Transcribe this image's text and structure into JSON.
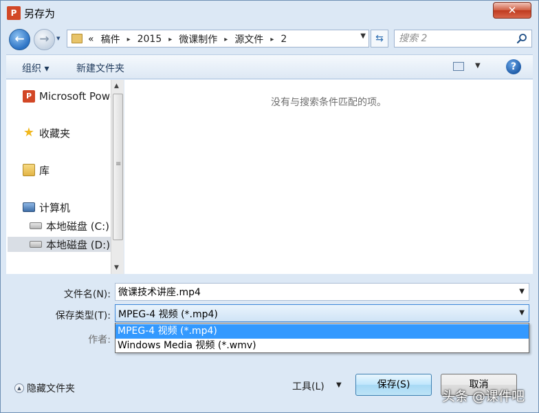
{
  "window": {
    "title": "另存为",
    "close_glyph": "✕"
  },
  "address": {
    "back_glyph": "←",
    "forward_glyph": "→",
    "history_glyph": "▾",
    "overflow": "«",
    "crumbs": [
      "稿件",
      "2015",
      "微课制作",
      "源文件",
      "2"
    ],
    "crumb_separator": "▸",
    "dropdown_glyph": "▼",
    "refresh_glyph": "⇆",
    "search_placeholder": "搜索 2"
  },
  "toolbar": {
    "organize_label": "组织 ▾",
    "new_folder_label": "新建文件夹",
    "view_drop_glyph": "▼",
    "help_glyph": "?"
  },
  "nav": {
    "items": [
      {
        "label": "Microsoft PowerPoint",
        "icon": "powerpoint-icon"
      },
      {
        "label": "收藏夹",
        "icon": "star-icon"
      },
      {
        "label": "库",
        "icon": "library-icon"
      },
      {
        "label": "计算机",
        "icon": "computer-icon"
      },
      {
        "label": "本地磁盘 (C:)",
        "icon": "drive-c-icon"
      },
      {
        "label": "本地磁盘 (D:)",
        "icon": "drive-d-icon"
      }
    ],
    "selected_index": 5
  },
  "content": {
    "empty_message": "没有与搜索条件匹配的项。"
  },
  "form": {
    "filename_label": "文件名(N):",
    "filename_value": "微课技术讲座.mp4",
    "filetype_label": "保存类型(T):",
    "filetype_value": "MPEG-4 视频 (*.mp4)",
    "author_label": "作者:",
    "filetype_options": [
      "MPEG-4 视频 (*.mp4)",
      "Windows Media 视频 (*.wmv)"
    ],
    "dropdown_glyph": "▼"
  },
  "footer": {
    "hide_folders_label": "隐藏文件夹",
    "hide_folders_glyph": "▲",
    "tools_label": "工具(L)",
    "tools_drop_glyph": "▼",
    "save_label": "保存(S)",
    "cancel_label": "取消"
  },
  "watermark": "头条 @课件吧",
  "colors": {
    "window_bg": "#dce8f5",
    "selection": "#3399ff",
    "close_button": "#c8462b",
    "nav_selected": "#d9dee5"
  }
}
